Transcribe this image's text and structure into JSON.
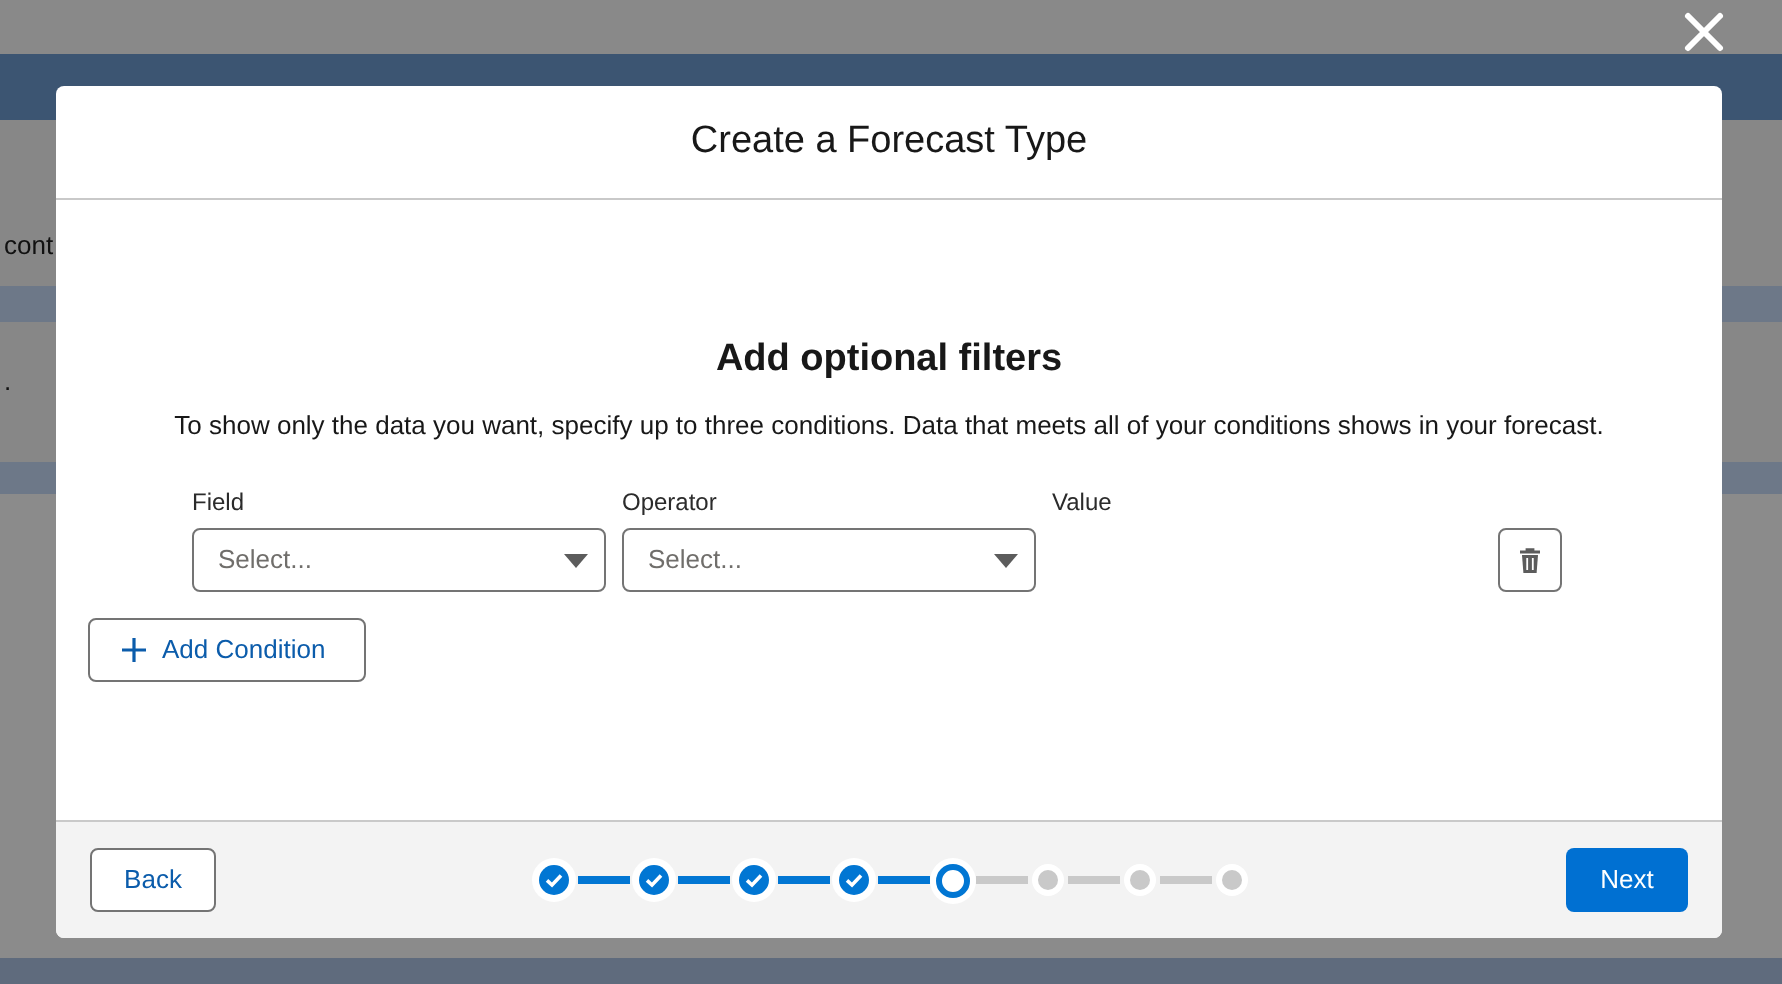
{
  "background": {
    "texts": [
      "cont",
      "."
    ]
  },
  "modal": {
    "title": "Create a Forecast Type",
    "heading": "Add optional filters",
    "description": "To show only the data you want, specify up to three conditions. Data that meets all of your conditions shows in your forecast.",
    "columns": [
      "Field",
      "Operator",
      "Value"
    ],
    "conditions": [
      {
        "field": {
          "placeholder": "Select..."
        },
        "operator": {
          "placeholder": "Select..."
        }
      }
    ],
    "add_button": "Add Condition",
    "back_button": "Back",
    "next_button": "Next",
    "steps": [
      {
        "completed": true,
        "selected": false
      },
      {
        "completed": true,
        "selected": false
      },
      {
        "completed": true,
        "selected": false
      },
      {
        "completed": true,
        "selected": false
      },
      {
        "completed": false,
        "selected": true
      },
      {
        "completed": false,
        "selected": false
      },
      {
        "completed": false,
        "selected": false
      },
      {
        "completed": false,
        "selected": false
      }
    ]
  }
}
